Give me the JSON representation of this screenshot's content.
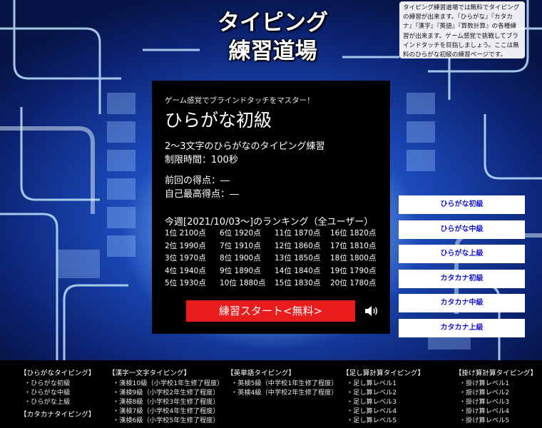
{
  "site": {
    "logo_line1": "タイピング",
    "logo_line2": "練習道場",
    "intro": "タイピング練習道場では無料でタイピングの練習が出来ます。『ひらがな』『カタカナ』『漢字』『英語』『算数計算』の各種練習が出来ます。ゲーム感覚で挑戦してブラインドタッチを目指しましょう。ここは無料のひらがな初級の練習ページです。"
  },
  "panel": {
    "tagline": "ゲーム感覚でブラインドタッチをマスター！",
    "title": "ひらがな初級",
    "desc1": "2～3文字のひらがなのタイピング練習",
    "desc2": "制限時間：100秒",
    "prev_score": "前回の得点：―",
    "best_score": "自己最高得点：―",
    "ranking_title": "今週[2021/10/03～]のランキング（全ユーザー）",
    "ranking_cols": [
      [
        "1位 2100点",
        "2位 1990点",
        "3位 1970点",
        "4位 1940点",
        "5位 1930点"
      ],
      [
        "6位 1920点",
        "7位 1910点",
        "8位 1900点",
        "9位 1890点",
        "10位 1880点"
      ],
      [
        "11位 1870点",
        "12位 1860点",
        "13位 1850点",
        "14位 1840点",
        "15位 1830点"
      ],
      [
        "16位 1820点",
        "17位 1810点",
        "18位 1800点",
        "19位 1790点",
        "20位 1780点"
      ]
    ],
    "start_label": "練習スタート<無料>",
    "sound_icon": "speaker-icon"
  },
  "courses": [
    "ひらがな初級",
    "ひらがな中級",
    "ひらがな上級",
    "カタカナ初級",
    "カタカナ中級",
    "カタカナ上級"
  ],
  "footer": {
    "col1_head": "【ひらがなタイピング】",
    "col1_items": [
      "・ひらがな初級",
      "・ひらがな中級",
      "・ひらがな上級"
    ],
    "col1_head2": "【カタカナタイピング】",
    "col2_head": "【漢字一文字タイピング】",
    "col2_items": [
      "・漢検10級（小学校1年生修了程度）",
      "・漢検9級（小学校2年生修了程度）",
      "・漢検8級（小学校3年生修了程度）",
      "・漢検7級（小学校4年生修了程度）",
      "・漢検6級（小学校5年生修了程度）"
    ],
    "col3_head": "【英単語タイピング】",
    "col3_items": [
      "・英検5級（中学校1年生修了程度）",
      "・英検4級（中学校2年生修了程度）"
    ],
    "col4_head": "【足し算計算タイピング】",
    "col4_items": [
      "・足し算レベル1",
      "・足し算レベル2",
      "・足し算レベル3",
      "・足し算レベル4",
      "・足し算レベル5"
    ],
    "col5_head": "【掛け算計算タイピング】",
    "col5_items": [
      "・掛け算レベル1",
      "・掛け算レベル2",
      "・掛け算レベル3",
      "・掛け算レベル4",
      "・掛け算レベル5"
    ]
  },
  "colors": {
    "start_button": "#e81c1c",
    "course_text": "#1515d0",
    "panel_bg": "#000000"
  }
}
